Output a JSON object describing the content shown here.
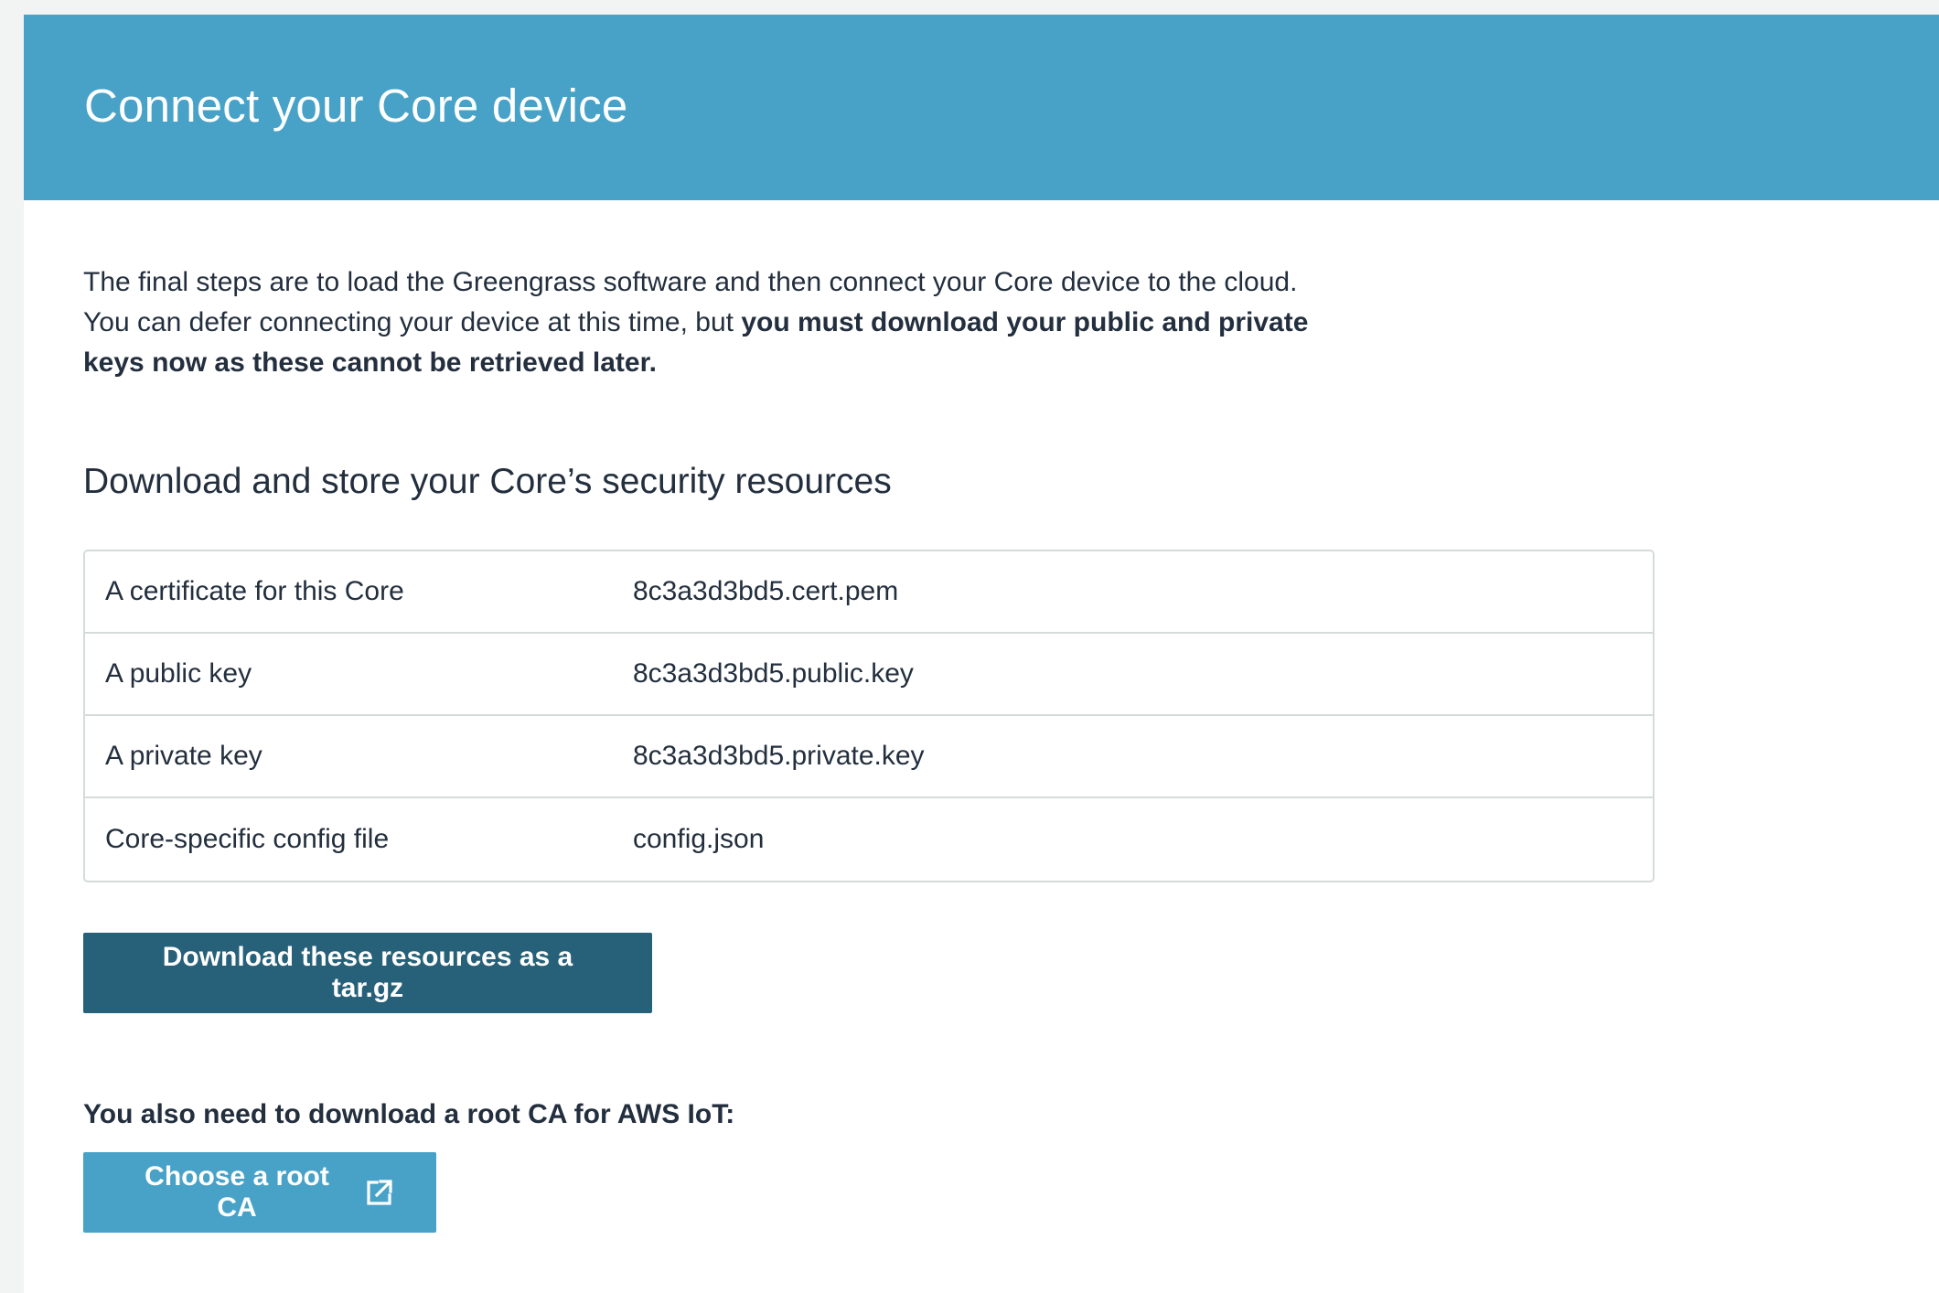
{
  "header": {
    "title": "Connect your Core device"
  },
  "intro": {
    "text_plain": "The final steps are to load the Greengrass software and then connect your Core device to the cloud. You can defer connecting your device at this time, but ",
    "text_bold": "you must download your public and private keys now as these cannot be retrieved later."
  },
  "security": {
    "title": "Download and store your Core’s security resources",
    "resources": [
      {
        "label": "A certificate for this Core",
        "file": "8c3a3d3bd5.cert.pem"
      },
      {
        "label": "A public key",
        "file": "8c3a3d3bd5.public.key"
      },
      {
        "label": "A private key",
        "file": "8c3a3d3bd5.private.key"
      },
      {
        "label": "Core-specific config file",
        "file": "config.json"
      }
    ],
    "download_label": "Download these resources as a tar.gz"
  },
  "root_ca": {
    "note": "You also need to download a root CA for AWS IoT:",
    "button_label": "Choose a root CA",
    "button_icon": "external-link-icon"
  },
  "colors": {
    "header_bg": "#48a2c8",
    "primary_button": "#266079",
    "secondary_button": "#48a2c8"
  }
}
